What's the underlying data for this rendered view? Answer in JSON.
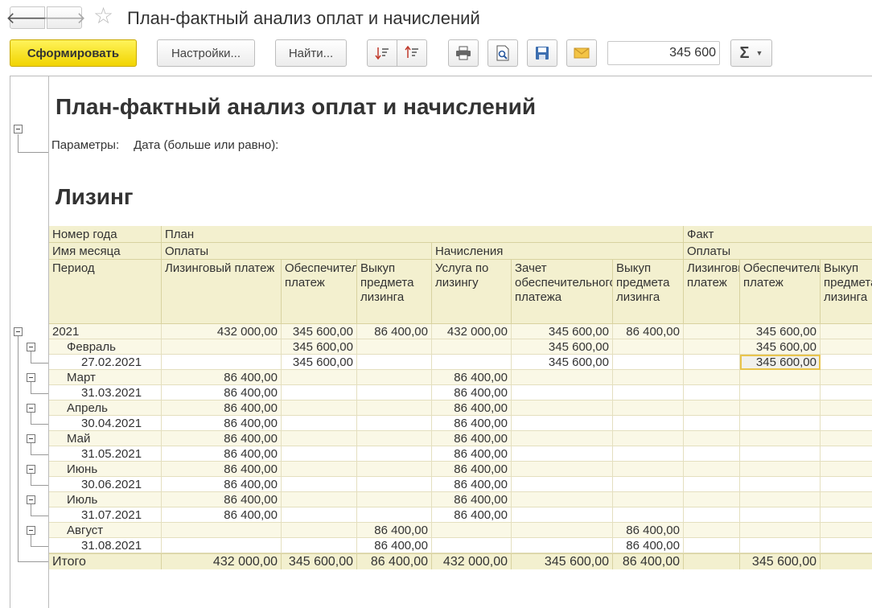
{
  "window": {
    "title": "План-фактный анализ оплат и начислений"
  },
  "toolbar": {
    "generate_label": "Сформировать",
    "settings_label": "Настройки...",
    "find_label": "Найти...",
    "sum_value": "345 600",
    "sigma_label": "Σ"
  },
  "report": {
    "title": "План-фактный анализ оплат и начислений",
    "params_label": "Параметры:",
    "params_value": "Дата (больше или равно):",
    "section_title": "Лизинг",
    "headers": {
      "year": "Номер года",
      "month": "Имя месяца",
      "period": "Период",
      "plan": "План",
      "fact": "Факт",
      "plan_payments": "Оплаты",
      "plan_accruals": "Начисления",
      "fact_payments": "Оплаты",
      "columns": [
        "Лизинговый платеж",
        "Обеспечительный платеж",
        "Выкуп предмета лизинга",
        "Услуга по лизингу",
        "Зачет обеспечительного платежа",
        "Выкуп предмета лизинга",
        "Лизинговый платеж",
        "Обеспечительный платеж",
        "Выкуп предмета лизинга"
      ]
    },
    "rows": [
      {
        "label": "2021",
        "level": 0,
        "values": [
          "432 000,00",
          "345 600,00",
          "86 400,00",
          "432 000,00",
          "345 600,00",
          "86 400,00",
          "",
          "345 600,00",
          ""
        ]
      },
      {
        "label": "Февраль",
        "level": 1,
        "values": [
          "",
          "345 600,00",
          "",
          "",
          "345 600,00",
          "",
          "",
          "345 600,00",
          ""
        ]
      },
      {
        "label": "27.02.2021",
        "level": 2,
        "values": [
          "",
          "345 600,00",
          "",
          "",
          "345 600,00",
          "",
          "",
          "345 600,00",
          ""
        ]
      },
      {
        "label": "Март",
        "level": 1,
        "values": [
          "86 400,00",
          "",
          "",
          "86 400,00",
          "",
          "",
          "",
          "",
          ""
        ]
      },
      {
        "label": "31.03.2021",
        "level": 2,
        "values": [
          "86 400,00",
          "",
          "",
          "86 400,00",
          "",
          "",
          "",
          "",
          ""
        ]
      },
      {
        "label": "Апрель",
        "level": 1,
        "values": [
          "86 400,00",
          "",
          "",
          "86 400,00",
          "",
          "",
          "",
          "",
          ""
        ]
      },
      {
        "label": "30.04.2021",
        "level": 2,
        "values": [
          "86 400,00",
          "",
          "",
          "86 400,00",
          "",
          "",
          "",
          "",
          ""
        ]
      },
      {
        "label": "Май",
        "level": 1,
        "values": [
          "86 400,00",
          "",
          "",
          "86 400,00",
          "",
          "",
          "",
          "",
          ""
        ]
      },
      {
        "label": "31.05.2021",
        "level": 2,
        "values": [
          "86 400,00",
          "",
          "",
          "86 400,00",
          "",
          "",
          "",
          "",
          ""
        ]
      },
      {
        "label": "Июнь",
        "level": 1,
        "values": [
          "86 400,00",
          "",
          "",
          "86 400,00",
          "",
          "",
          "",
          "",
          ""
        ]
      },
      {
        "label": "30.06.2021",
        "level": 2,
        "values": [
          "86 400,00",
          "",
          "",
          "86 400,00",
          "",
          "",
          "",
          "",
          ""
        ]
      },
      {
        "label": "Июль",
        "level": 1,
        "values": [
          "86 400,00",
          "",
          "",
          "86 400,00",
          "",
          "",
          "",
          "",
          ""
        ]
      },
      {
        "label": "31.07.2021",
        "level": 2,
        "values": [
          "86 400,00",
          "",
          "",
          "86 400,00",
          "",
          "",
          "",
          "",
          ""
        ]
      },
      {
        "label": "Август",
        "level": 1,
        "values": [
          "",
          "",
          "86 400,00",
          "",
          "",
          "86 400,00",
          "",
          "",
          ""
        ]
      },
      {
        "label": "31.08.2021",
        "level": 2,
        "values": [
          "",
          "",
          "86 400,00",
          "",
          "",
          "86 400,00",
          "",
          "",
          ""
        ]
      }
    ],
    "total": {
      "label": "Итого",
      "values": [
        "432 000,00",
        "345 600,00",
        "86 400,00",
        "432 000,00",
        "345 600,00",
        "86 400,00",
        "",
        "345 600,00",
        ""
      ]
    }
  }
}
